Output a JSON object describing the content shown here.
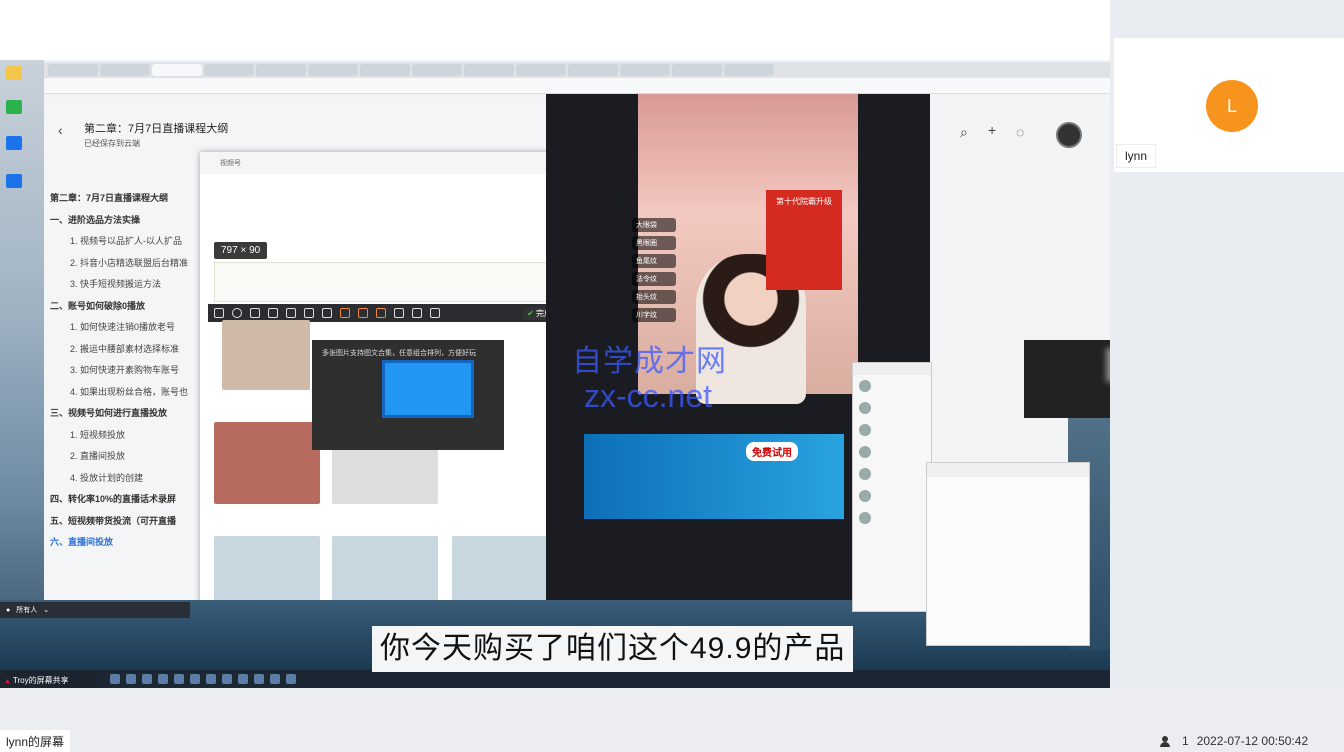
{
  "doc": {
    "title": "第二章：7月7日直播课程大纲",
    "saved": "已经保存到云端",
    "outline": [
      {
        "text": "第二章：7月7日直播课程大纲",
        "level": "h"
      },
      {
        "text": "一、进阶选品方法实操",
        "level": "h"
      },
      {
        "text": "1. 视频号以品扩人-以人扩品",
        "level": "i"
      },
      {
        "text": "2. 抖音小店精选联盟后台精准",
        "level": "i"
      },
      {
        "text": "3. 快手短视频搬运方法",
        "level": "i"
      },
      {
        "text": "二、账号如何破除0播放",
        "level": "h"
      },
      {
        "text": "1. 如何快速注销0播放老号",
        "level": "i"
      },
      {
        "text": "2. 搬运中腰部素材选择标准",
        "level": "i"
      },
      {
        "text": "3. 如何快速开素购物车账号",
        "level": "i"
      },
      {
        "text": "4. 如果出现粉丝合格，账号也",
        "level": "i"
      },
      {
        "text": "三、视频号如何进行直播投放",
        "level": "h"
      },
      {
        "text": "1. 短视频投放",
        "level": "i"
      },
      {
        "text": "2. 直播间投放",
        "level": "i"
      },
      {
        "text": "4. 投放计划的创建",
        "level": "i"
      },
      {
        "text": "四、转化率10%的直播话术录屏",
        "level": "h"
      },
      {
        "text": "五、短视频带货投流（可开直播",
        "level": "h"
      },
      {
        "text": "六、直播间投放",
        "level": "sel"
      }
    ]
  },
  "wechat": {
    "header": "视频号",
    "size_badge": "797 × 90",
    "done_label": "完成",
    "popup_text": "多张图片支持图文合集，任意组合排列，方便好玩"
  },
  "phone": {
    "chips": [
      "大眼袋",
      "黑眼圈",
      "鱼尾纹",
      "法令纹",
      "抬头纹",
      "川字纹"
    ],
    "promo_text": "第十代院霸升级",
    "trial": "免费试用"
  },
  "watermark": {
    "line1": "自学成才网",
    "line2": "zx-cc.net"
  },
  "subtitle": "你今天购买了咱们这个49.9的产品",
  "share_tag": "Troy的屏幕共享",
  "chat_bar": "所有人",
  "side": {
    "avatar_letter": "L",
    "name": "lynn"
  },
  "bottom": {
    "screen_label": "lynn的屏幕",
    "participants": "1",
    "datetime": "2022-07-12 00:50:42"
  }
}
